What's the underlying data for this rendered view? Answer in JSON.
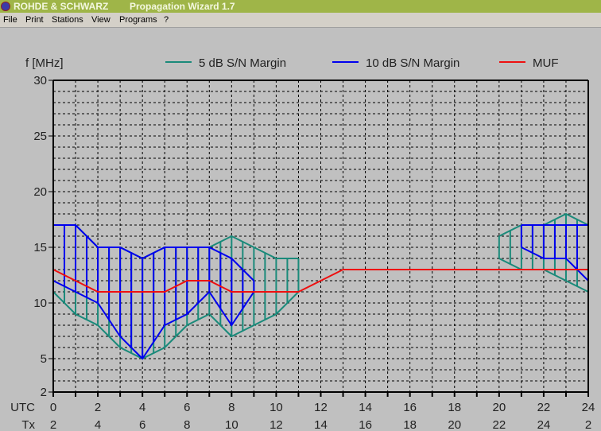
{
  "window": {
    "company": "ROHDE & SCHWARZ",
    "title": "Propagation Wizard  1.7"
  },
  "menu": [
    "File",
    "Print",
    "Stations",
    "View",
    "Programs",
    "?"
  ],
  "colors": {
    "titlebar": "#9fb548",
    "background": "#c0c0c0",
    "margin5": "#1a8a7a",
    "margin10": "#0000ee",
    "muf": "#ee1010"
  },
  "chart_data": {
    "type": "area",
    "ylabel": "f [MHz]",
    "ylim": [
      2,
      30
    ],
    "yticks": [
      30,
      25,
      20,
      15,
      10,
      5,
      2
    ],
    "xlim": [
      0,
      24
    ],
    "grid": true,
    "legend_position": "top",
    "x_axis_rows": [
      {
        "label": "UTC",
        "ticks": [
          "0",
          "2",
          "4",
          "6",
          "8",
          "10",
          "12",
          "14",
          "16",
          "18",
          "20",
          "22",
          "24"
        ]
      },
      {
        "label": "Tx",
        "ticks": [
          "2",
          "4",
          "6",
          "8",
          "10",
          "12",
          "14",
          "16",
          "18",
          "20",
          "22",
          "24",
          "2"
        ]
      }
    ],
    "series": [
      {
        "name": "5 dB S/N Margin",
        "color": "#1a8a7a",
        "segments": [
          {
            "x": [
              0,
              1,
              2,
              3,
              4,
              5,
              6,
              7,
              8,
              9,
              10,
              11
            ],
            "upper": [
              17,
              17,
              15,
              15,
              14,
              15,
              15,
              15,
              16,
              15,
              14,
              14
            ],
            "lower": [
              11,
              9,
              8,
              6,
              5,
              6,
              8,
              9,
              7,
              8,
              9,
              11
            ]
          },
          {
            "x": [
              20,
              21,
              22,
              23,
              24
            ],
            "upper": [
              16,
              17,
              17,
              18,
              17
            ],
            "lower": [
              14,
              13,
              13,
              12,
              11
            ]
          }
        ]
      },
      {
        "name": "10 dB S/N Margin",
        "color": "#0000ee",
        "segments": [
          {
            "x": [
              0,
              1,
              2,
              3,
              4,
              5,
              6,
              7,
              8,
              9
            ],
            "upper": [
              17,
              17,
              15,
              15,
              14,
              15,
              15,
              15,
              14,
              12
            ],
            "lower": [
              12,
              11,
              10,
              7,
              5,
              8,
              9,
              11,
              8,
              11
            ]
          },
          {
            "x": [
              21,
              22,
              23,
              24
            ],
            "upper": [
              17,
              17,
              17,
              17
            ],
            "lower": [
              15,
              14,
              14,
              12
            ]
          }
        ]
      },
      {
        "name": "MUF",
        "color": "#ee1010",
        "x": [
          0,
          1,
          2,
          3,
          4,
          5,
          6,
          7,
          8,
          9,
          10,
          11,
          12,
          13,
          14,
          15,
          16,
          17,
          18,
          19,
          20,
          21,
          22,
          23,
          24
        ],
        "values": [
          13,
          12,
          11,
          11,
          11,
          11,
          12,
          12,
          11,
          11,
          11,
          11,
          12,
          13,
          13,
          13,
          13,
          13,
          13,
          13,
          13,
          13,
          13,
          13,
          13
        ]
      }
    ]
  }
}
